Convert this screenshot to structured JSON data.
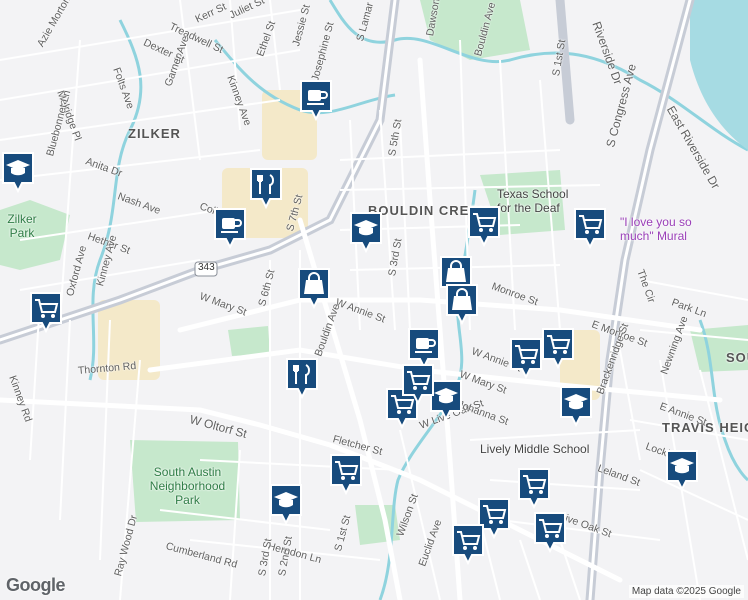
{
  "map": {
    "logo": "Google",
    "attribution": "Map data ©2025 Google",
    "districts": [
      "ZILKER",
      "BOULDIN CREEK",
      "SOUTH RIVER",
      "TRAVIS HEIGHTS"
    ],
    "parks": [
      "South Austin Neighborhood Park",
      "Zilker Park"
    ],
    "places": [
      "Texas School for the Deaf",
      "Lively Middle School",
      "\"I love you so much\" Mural"
    ],
    "route_shield": "343",
    "streets": [
      "Juliet St",
      "Kerr St",
      "Treadwell St",
      "Kinney Ave",
      "Ethel St",
      "Jessie St",
      "Josephine St",
      "S Lamar Blvd",
      "Dexter St",
      "Folts Ave",
      "Garner Ave",
      "Melridge Pl",
      "Azie Morton Rd",
      "Bluebonnet Ln",
      "Anita Dr",
      "Nash Ave",
      "Hether St",
      "Oxford Ave",
      "Kinney Ave",
      "S 7th St",
      "S 6th St",
      "W Mary St",
      "W Annie St",
      "W Oltorf St",
      "Thornton Rd",
      "Kinney Rd",
      "Bouldin Ave",
      "S 3rd St",
      "S 5th St",
      "Dawson Rd",
      "Bouldin Ave",
      "W Live Oak St",
      "Fletcher St",
      "S 1st St",
      "S 2nd St",
      "Herndon Ln",
      "Cumberland Rd",
      "Wilson St",
      "Euclid Ave",
      "E Monroe St",
      "Monroe St",
      "W Annie St",
      "W Mary St",
      "Brackenridge St",
      "E Annie St",
      "Park Ln",
      "The Cir",
      "Newning Ave",
      "S Congress Ave",
      "East Riverside Dr",
      "Riverside Dr",
      "S 1st St",
      "Leland St",
      "Lockhart Dr",
      "Live Oak St",
      "S 3rd St",
      "Johanna St",
      "Collier St",
      "Ray Wood Dr"
    ]
  },
  "markers": [
    {
      "type": "coffee-icon"
    },
    {
      "type": "restaurant-icon"
    },
    {
      "type": "coffee-icon"
    },
    {
      "type": "school-icon"
    },
    {
      "type": "school-icon"
    },
    {
      "type": "shopping-icon"
    },
    {
      "type": "shopping-cart-icon"
    },
    {
      "type": "restaurant-icon"
    },
    {
      "type": "shopping-cart-icon"
    },
    {
      "type": "school-icon"
    },
    {
      "type": "shopping-cart-icon"
    },
    {
      "type": "school-icon"
    },
    {
      "type": "shopping-cart-icon"
    },
    {
      "type": "shopping-cart-icon"
    },
    {
      "type": "shopping-cart-icon"
    },
    {
      "type": "shopping-cart-icon"
    },
    {
      "type": "shopping-cart-icon"
    },
    {
      "type": "shopping-icon"
    },
    {
      "type": "shopping-icon"
    },
    {
      "type": "coffee-icon"
    },
    {
      "type": "shopping-cart-icon"
    },
    {
      "type": "school-icon"
    },
    {
      "type": "school-icon"
    },
    {
      "type": "shopping-cart-icon"
    },
    {
      "type": "shopping-cart-icon"
    },
    {
      "type": "shopping-cart-icon"
    }
  ],
  "colors": {
    "marker_fill": "#174b7d",
    "marker_border": "#ffffff",
    "water": "#8fd3de",
    "park": "#bfe6c6",
    "highway": "#c9cdd6",
    "commercial": "#f2e6c3"
  }
}
